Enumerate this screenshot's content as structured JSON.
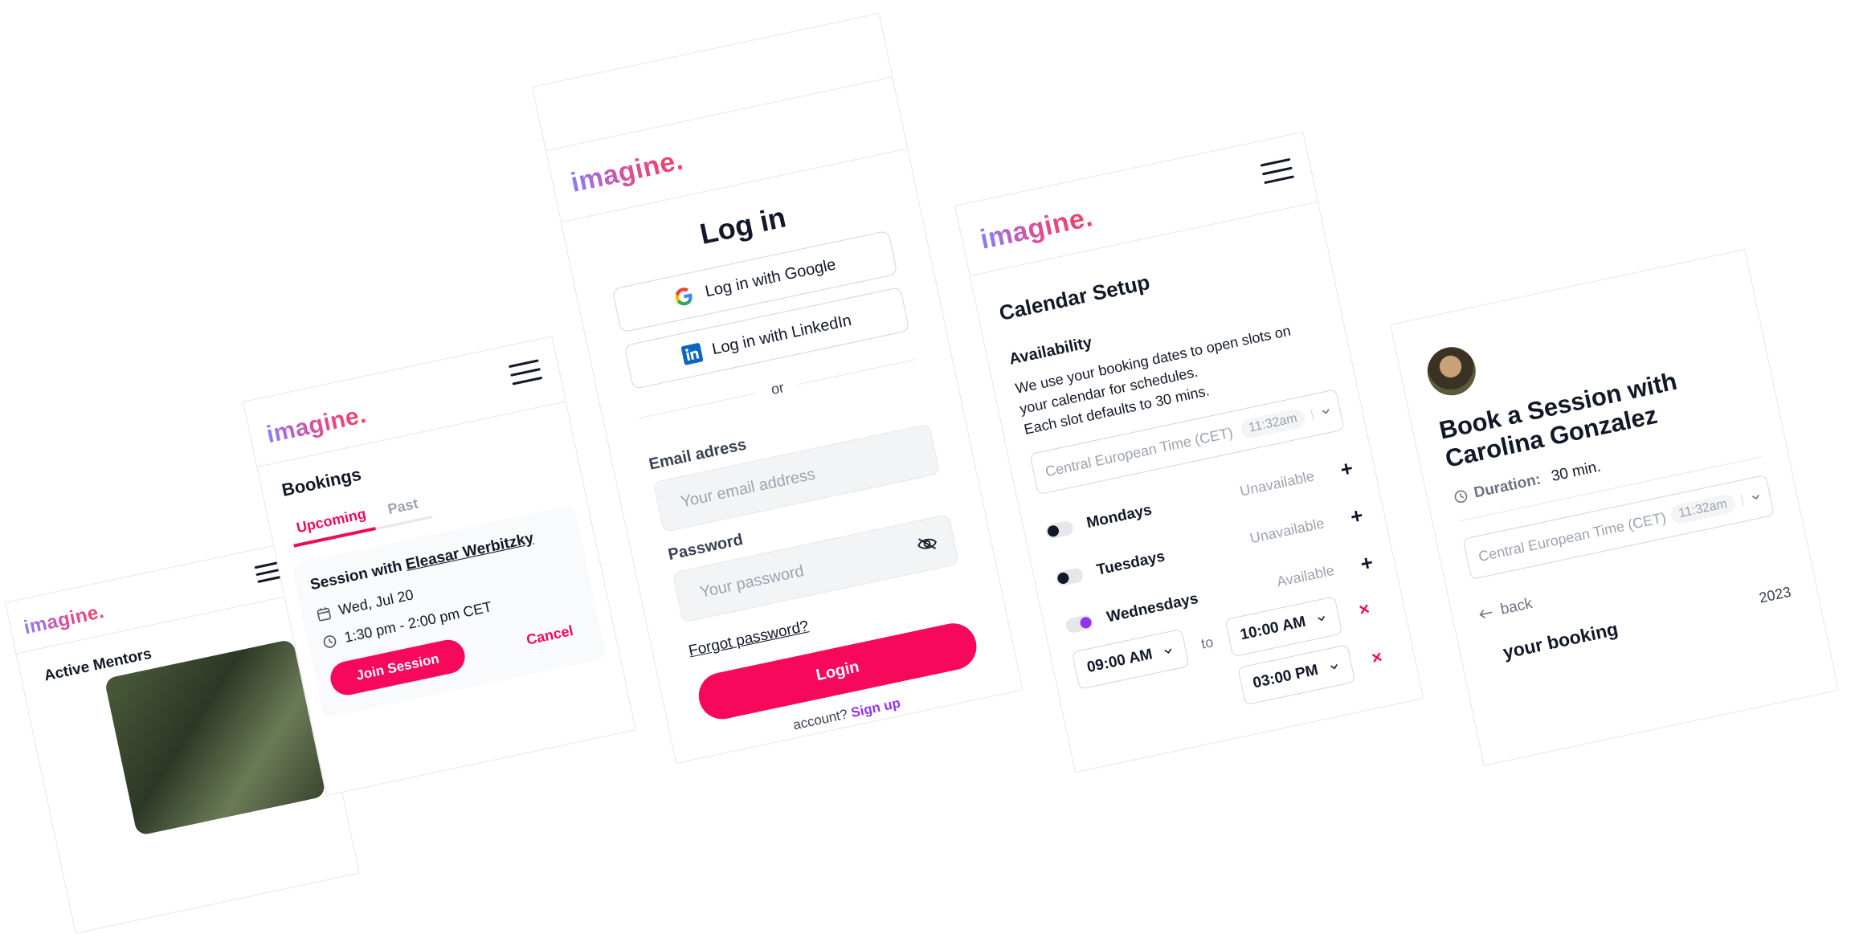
{
  "brand": {
    "logo": "imagine.",
    "accent": "#f6095a",
    "link": "#9333ea"
  },
  "mentors_screen": {
    "section_title": "Active Mentors"
  },
  "bookings_screen": {
    "title": "Bookings",
    "tabs": [
      {
        "label": "Upcoming",
        "active": true
      },
      {
        "label": "Past",
        "active": false
      }
    ],
    "session": {
      "prefix": "Session with ",
      "mentor": "Eleasar Werbitzky",
      "date": "Wed, Jul 20",
      "time": "1:30 pm - 2:00 pm CET",
      "join_label": "Join Session",
      "cancel_label": "Cancel"
    }
  },
  "login_screen": {
    "title": "Log in",
    "google_label": "Log in with Google",
    "linkedin_label": "Log in with LinkedIn",
    "divider": "or",
    "email_label": "Email adress",
    "email_placeholder": "Your email address",
    "password_label": "Password",
    "password_placeholder": "Your password",
    "forgot_label": "Forgot password?",
    "login_label": "Login",
    "signup_prompt": "account?",
    "signup_label": "Sign up"
  },
  "calendar_screen": {
    "title": "Calendar Setup",
    "section": "Availability",
    "description_1": "We use your booking dates to open slots on",
    "description_2": "your calendar for schedules.",
    "description_3": "Each slot defaults to 30 mins.",
    "timezone": "Central European Time (CET)",
    "timezone_time": "11:32am",
    "days": [
      {
        "name": "Mondays",
        "status": "Unavailable"
      },
      {
        "name": "Tuesdays",
        "status": "Unavailable"
      },
      {
        "name": "Wednesdays",
        "status": "Available"
      }
    ],
    "slots": [
      {
        "from": "09:00 AM",
        "to": "10:00 AM"
      },
      {
        "to": "03:00 PM"
      }
    ],
    "to_word": "to"
  },
  "book_screen": {
    "title_1": "Book a Session with",
    "title_2": "Carolina Gonzalez",
    "duration_label": "Duration:",
    "duration_value": "30 min.",
    "timezone": "Central European Time (CET)",
    "timezone_time": "11:32am",
    "back_label": "back",
    "booking_heading": "your booking",
    "year_fragment": "2023"
  }
}
